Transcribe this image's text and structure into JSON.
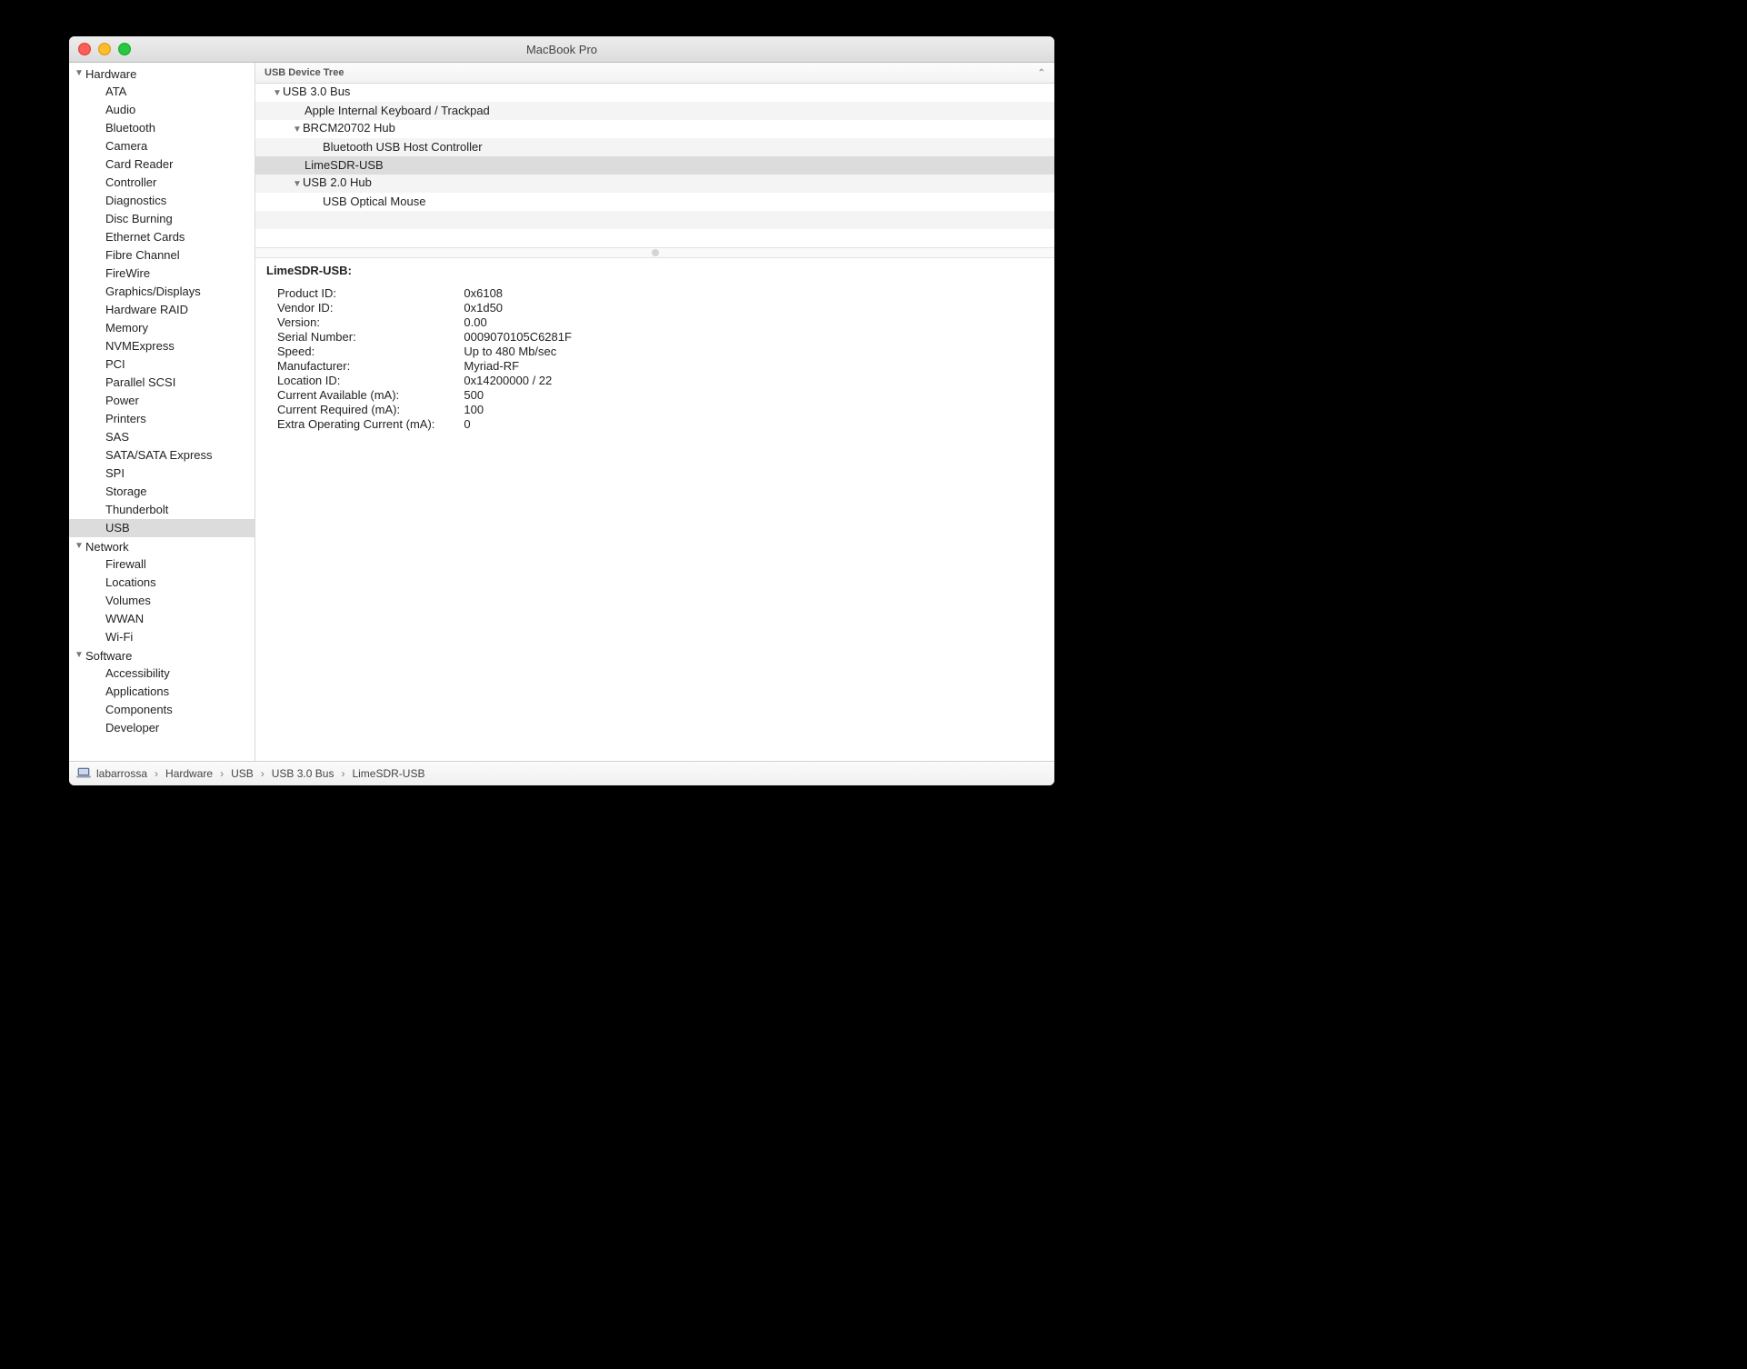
{
  "window": {
    "title": "MacBook Pro"
  },
  "sidebar": {
    "categories": [
      {
        "label": "Hardware",
        "expanded": true,
        "items": [
          "ATA",
          "Audio",
          "Bluetooth",
          "Camera",
          "Card Reader",
          "Controller",
          "Diagnostics",
          "Disc Burning",
          "Ethernet Cards",
          "Fibre Channel",
          "FireWire",
          "Graphics/Displays",
          "Hardware RAID",
          "Memory",
          "NVMExpress",
          "PCI",
          "Parallel SCSI",
          "Power",
          "Printers",
          "SAS",
          "SATA/SATA Express",
          "SPI",
          "Storage",
          "Thunderbolt",
          "USB"
        ],
        "selected_index": 24
      },
      {
        "label": "Network",
        "expanded": true,
        "items": [
          "Firewall",
          "Locations",
          "Volumes",
          "WWAN",
          "Wi-Fi"
        ]
      },
      {
        "label": "Software",
        "expanded": true,
        "items": [
          "Accessibility",
          "Applications",
          "Components",
          "Developer"
        ]
      }
    ]
  },
  "tree": {
    "header": "USB Device Tree",
    "rows": [
      {
        "label": "USB 3.0 Bus",
        "depth": 0,
        "disclosure": true,
        "alt": false,
        "selected": false
      },
      {
        "label": "Apple Internal Keyboard / Trackpad",
        "depth": 1,
        "disclosure": false,
        "alt": true,
        "selected": false
      },
      {
        "label": "BRCM20702 Hub",
        "depth": 1,
        "disclosure": true,
        "alt": false,
        "selected": false
      },
      {
        "label": "Bluetooth USB Host Controller",
        "depth": 2,
        "disclosure": false,
        "alt": true,
        "selected": false
      },
      {
        "label": "LimeSDR-USB",
        "depth": 1,
        "disclosure": false,
        "alt": false,
        "selected": true
      },
      {
        "label": "USB 2.0 Hub",
        "depth": 1,
        "disclosure": true,
        "alt": true,
        "selected": false
      },
      {
        "label": "USB Optical Mouse",
        "depth": 2,
        "disclosure": false,
        "alt": false,
        "selected": false
      }
    ]
  },
  "detail": {
    "title": "LimeSDR-USB:",
    "rows": [
      {
        "key": "Product ID:",
        "value": "0x6108"
      },
      {
        "key": "Vendor ID:",
        "value": "0x1d50"
      },
      {
        "key": "Version:",
        "value": "0.00"
      },
      {
        "key": "Serial Number:",
        "value": "0009070105C6281F"
      },
      {
        "key": "Speed:",
        "value": "Up to 480 Mb/sec"
      },
      {
        "key": "Manufacturer:",
        "value": "Myriad-RF"
      },
      {
        "key": "Location ID:",
        "value": "0x14200000 / 22"
      },
      {
        "key": "Current Available (mA):",
        "value": "500"
      },
      {
        "key": "Current Required (mA):",
        "value": "100"
      },
      {
        "key": "Extra Operating Current (mA):",
        "value": "0"
      }
    ]
  },
  "path": {
    "computer": "labarrossa",
    "segments": [
      "Hardware",
      "USB",
      "USB 3.0 Bus",
      "LimeSDR-USB"
    ]
  }
}
